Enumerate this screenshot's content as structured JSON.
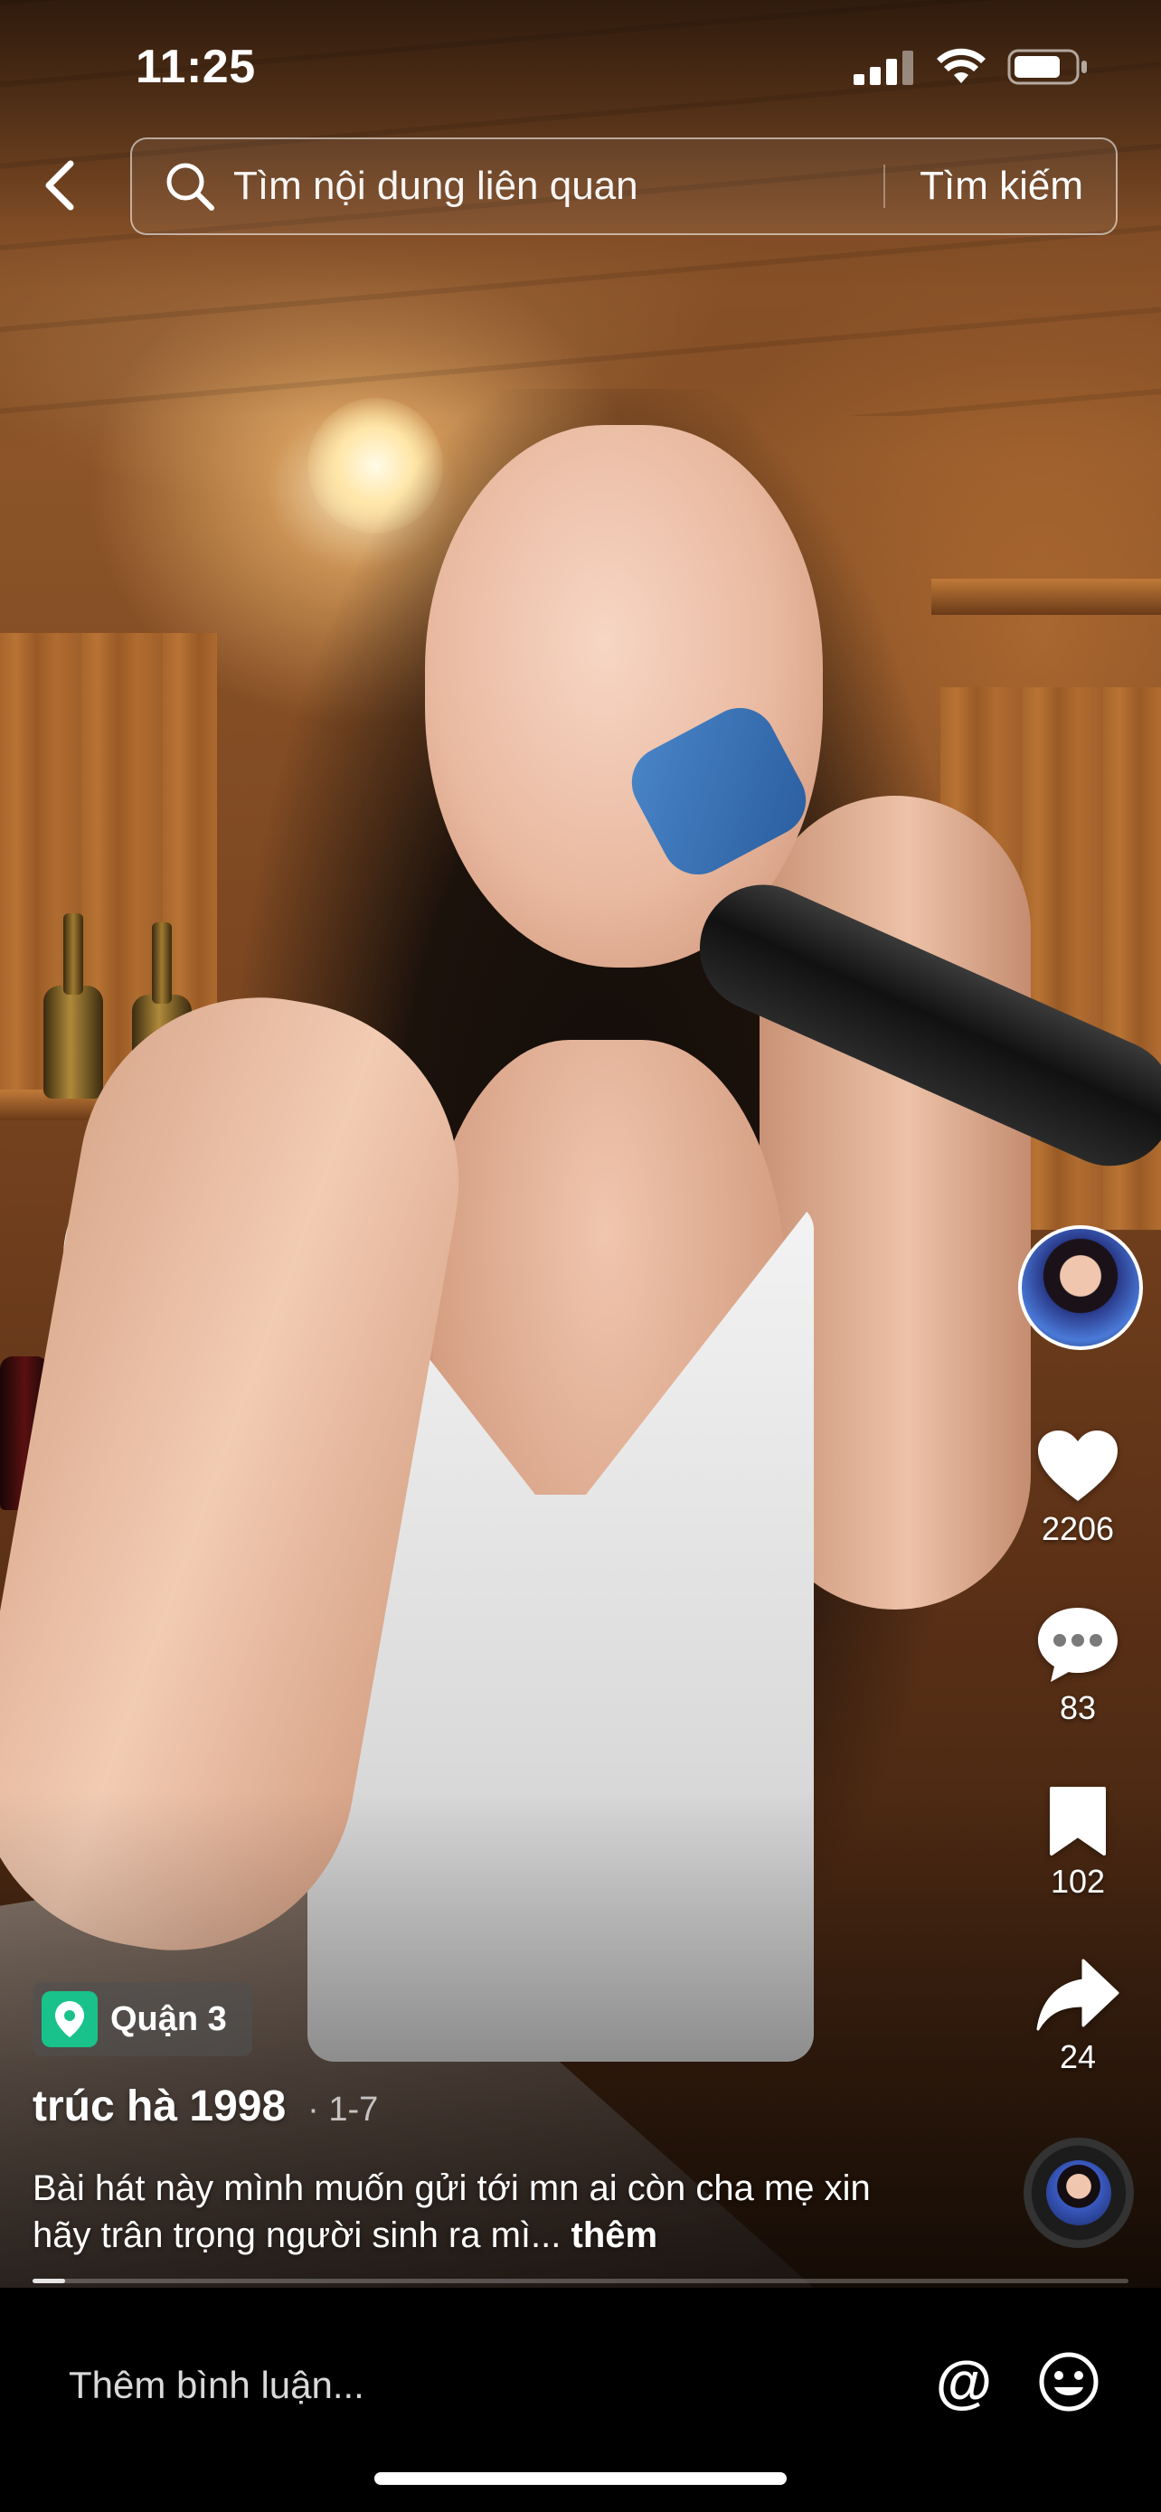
{
  "status_bar": {
    "time": "11:25"
  },
  "search": {
    "placeholder": "Tìm nội dung liên quan",
    "submit_label": "Tìm kiếm"
  },
  "actions": {
    "likes": "2206",
    "comments": "83",
    "saves": "102",
    "shares": "24"
  },
  "video": {
    "location": "Quận 3",
    "author": "trúc hà 1998",
    "date": "1-7",
    "caption": "Bài hát này mình muốn gửi tới mn ai còn cha mẹ xin hãy trân trọng người sinh ra mì...",
    "more_label": "thêm",
    "progress": 0.03
  },
  "comment_bar": {
    "placeholder": "Thêm bình luận...",
    "mention_symbol": "@"
  },
  "icons": {
    "back": "chevron-left-icon",
    "search": "search-icon",
    "like": "heart-icon",
    "comment": "speech-bubble-icon",
    "save": "bookmark-icon",
    "share": "share-arrow-icon",
    "location": "location-pin-icon",
    "emoji": "smiley-icon"
  },
  "colors": {
    "location_accent": "#19c28a",
    "background": "#000000",
    "text": "#ffffff"
  }
}
